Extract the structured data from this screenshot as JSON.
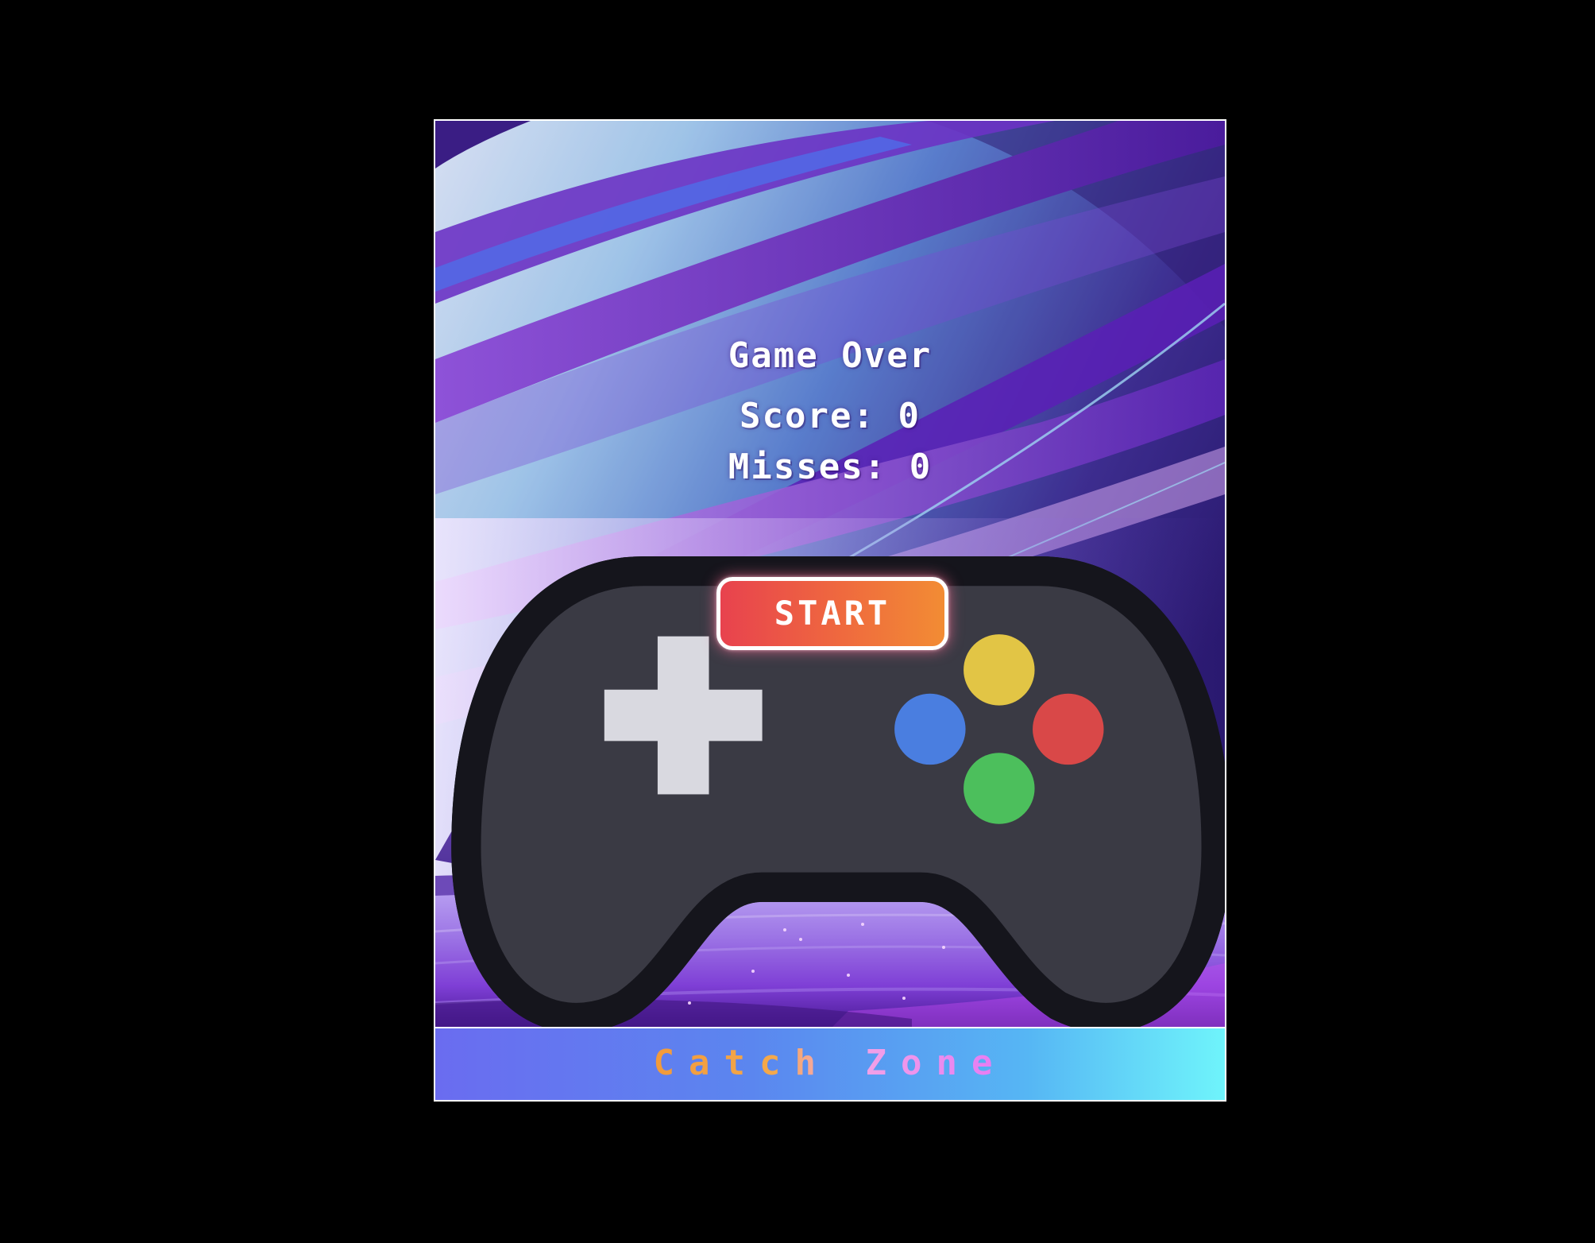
{
  "game": {
    "title": "Game Over",
    "title_icon": "gamepad-icon",
    "score_text": "Score: 0",
    "misses_text": "Misses: 0",
    "start_label": "START",
    "catch_zone_label": "Catch Zone"
  },
  "colors": {
    "page_background": "#000000",
    "frame_border": "#ffffff",
    "start_button_left": "#e8424e",
    "start_button_right": "#f28c34",
    "catch_zone_left": "#6a6cf0",
    "catch_zone_right": "#6ff4fb",
    "catch_label_left": "#f29a3a",
    "catch_label_right": "#e679f4"
  }
}
